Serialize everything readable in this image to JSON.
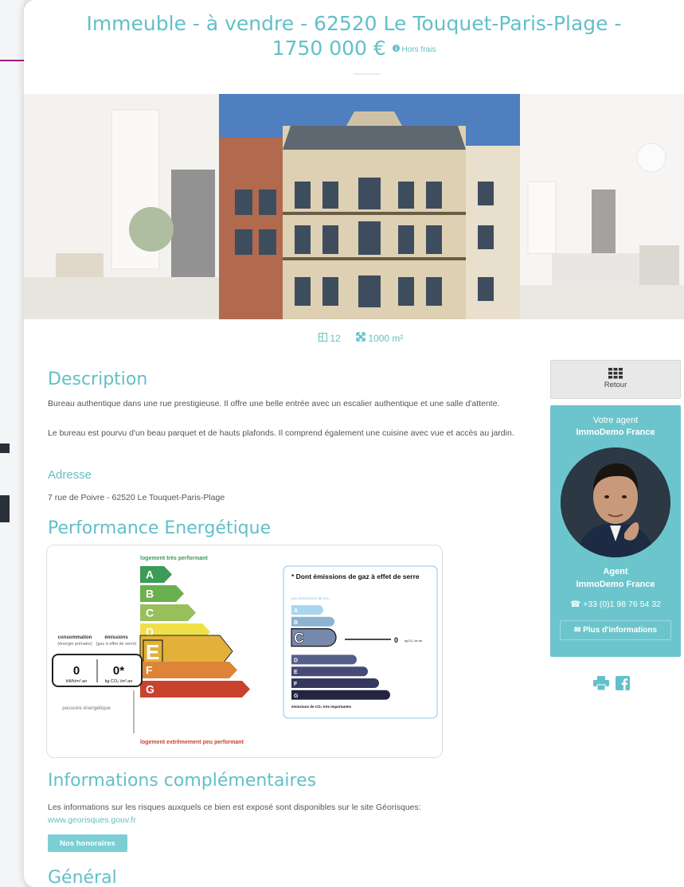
{
  "header": {
    "title_line1": "Immeuble - à vendre - 62520 Le Touquet-Paris-Plage -",
    "price": "1750 000 €",
    "price_note": "Hors frais"
  },
  "specs": {
    "rooms": "12",
    "area": "1000 m²"
  },
  "description": {
    "heading": "Description",
    "para1": "Bureau authentique dans une rue prestigieuse. Il offre une belle entrée avec un escalier authentique et une salle d'attente.",
    "para2": "Le bureau est pourvu d'un beau parquet et de hauts plafonds. Il comprend également une cuisine avec vue et accès au jardin."
  },
  "address": {
    "heading": "Adresse",
    "value": "7 rue de Poivre - 62520 Le Touquet-Paris-Plage"
  },
  "energy": {
    "heading": "Performance Energétique",
    "top_label": "logement très performant",
    "bottom_label": "logement extrêmement peu performant",
    "consumption_label": "consommation",
    "consumption_sub": "(énergie primaire)",
    "emissions_label": "émissions",
    "emissions_sub": "(gaz à effet de serre)",
    "consumption_value": "0",
    "consumption_unit": "kWh/m².an",
    "emissions_value": "0*",
    "emissions_unit": "kg CO₂ /m².an",
    "rating": "E",
    "passoire": "passoire énergétique",
    "classes": [
      "A",
      "B",
      "C",
      "D",
      "E",
      "F",
      "G"
    ],
    "colors": [
      "#3c9b57",
      "#6bb04e",
      "#97c05d",
      "#efe04a",
      "#e3b13a",
      "#dd8439",
      "#c8422f"
    ],
    "ges_title": "* Dont émissions de gaz à effet de serre",
    "ges_low": "peu d'émissions de CO₂",
    "ges_high": "émissions de CO₂ très importantes",
    "ges_value": "0",
    "ges_unit": "kg CO₂ /m².an",
    "ges_rating": "C",
    "ges_colors": [
      "#a8d6ef",
      "#8eb3d2",
      "#7789ab",
      "#555e8a",
      "#464a77",
      "#36375f",
      "#252541"
    ]
  },
  "info": {
    "heading": "Informations complémentaires",
    "text": "Les informations sur les risques auxquels ce bien est exposé sont disponibles sur le site Géorisques:",
    "link": "www.georisques.gouv.fr",
    "fees_button": "Nos honoraires"
  },
  "general": {
    "heading": "Général"
  },
  "sidebar": {
    "back_label": "Retour",
    "agent_intro": "Votre agent",
    "agency": "ImmoDemo France",
    "agent_title": "Agent",
    "agent_agency": "ImmoDemo France",
    "phone": "+33 (0)1 98 76 54 32",
    "more_button": "Plus d'informations"
  },
  "theme": {
    "accent": "#62c0c8",
    "arrow": "#a3197e"
  }
}
